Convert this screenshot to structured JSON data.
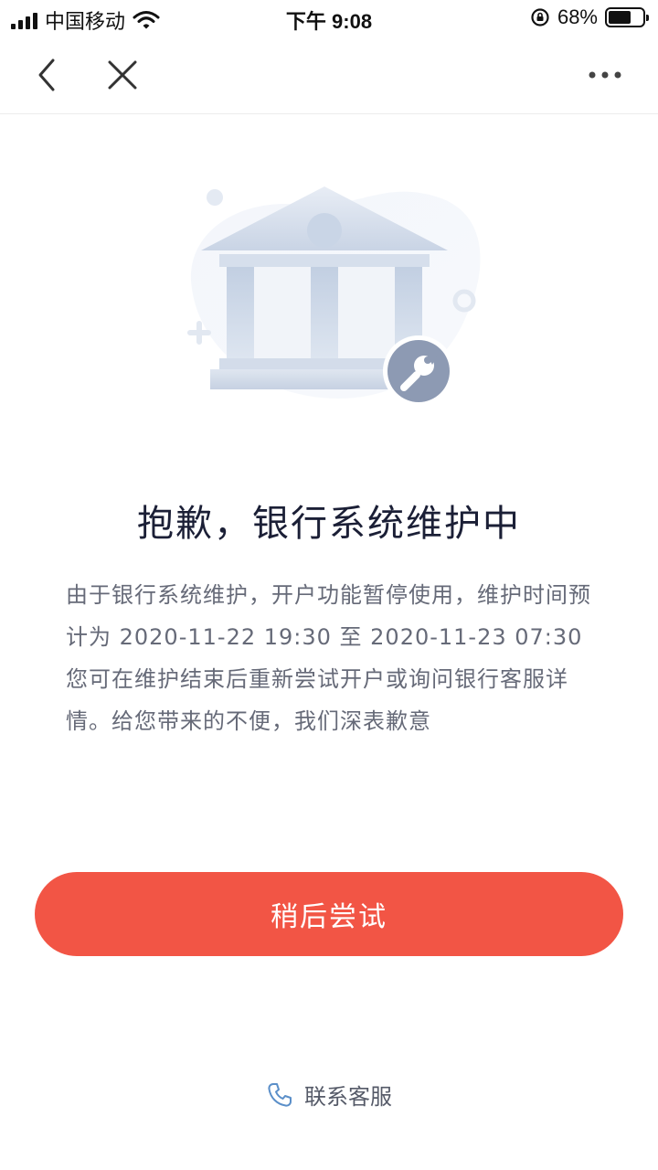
{
  "status_bar": {
    "carrier": "中国移动",
    "time": "下午 9:08",
    "battery_percent": "68%",
    "battery_level": 0.68
  },
  "nav": {
    "back_icon": "chevron-left-icon",
    "close_icon": "close-icon",
    "more_icon": "more-horizontal-icon"
  },
  "illustration": {
    "icon": "bank-maintenance-illustration",
    "badge_icon": "wrench-icon"
  },
  "main": {
    "title": "抱歉，银行系统维护中",
    "message": "由于银行系统维护，开户功能暂停使用，维护时间预计为 2020-11-22 19:30 至 2020-11-23 07:30\n您可在维护结束后重新尝试开户或询问银行客服详情。给您带来的不便，我们深表歉意"
  },
  "actions": {
    "retry_label": "稍后尝试",
    "contact_label": "联系客服",
    "contact_icon": "phone-icon"
  },
  "colors": {
    "accent": "#f25545",
    "title": "#1b1f36",
    "body_text": "#666a78",
    "icon_blue": "#5b8fc9"
  }
}
